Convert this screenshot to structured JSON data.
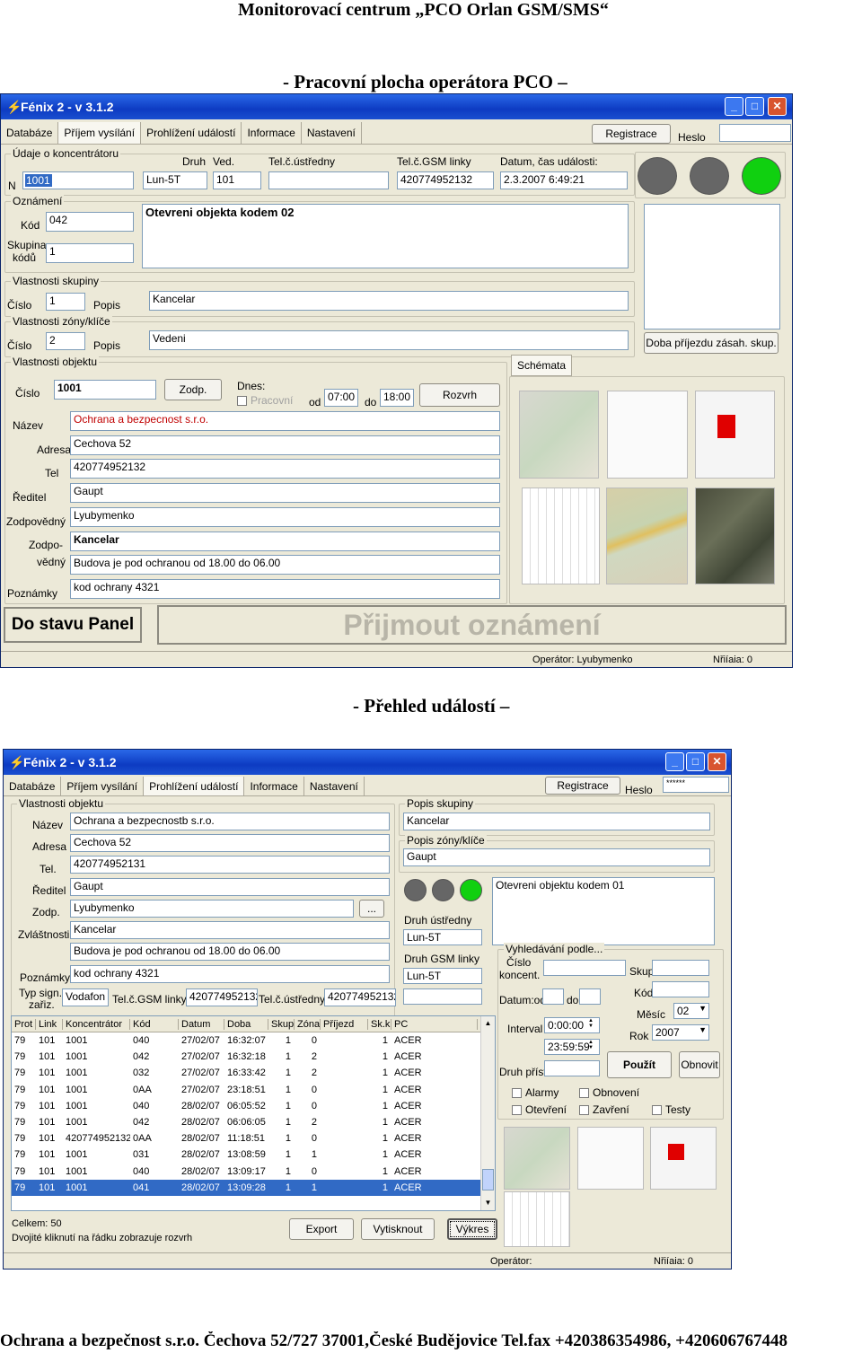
{
  "doc": {
    "header": "Monitorovací centrum „PCO Orlan GSM/SMS“",
    "section1": "-   Pracovní plocha operátora PCO –",
    "section2": "-   Přehled událostí –",
    "footer": "Ochrana a bezpečnost s.r.o.  Čechova 52/727  37001,České Budějovice  Tel.fax +420386354986,  +420606767448"
  },
  "w1": {
    "title": "Fénix 2 - v 3.1.2",
    "menu": [
      "Databáze",
      "Příjem vysílání",
      "Prohlížení událostí",
      "Informace",
      "Nastavení"
    ],
    "registrace": "Registrace",
    "heslo": "Heslo",
    "udaje_label": "Údaje o koncentrátoru",
    "druh_label": "Druh",
    "ved_label": "Ved.",
    "telc_label": "Tel.č.ústředny",
    "gsm_label": "Tel.č.GSM linky",
    "datum_label": "Datum, čas události:",
    "n_label": "N",
    "n_value": "1001",
    "druh_value": "Lun-5T",
    "ved_value": "101",
    "telc_value": "",
    "gsm_value": "420774952132",
    "datum_value": "2.3.2007 6:49:21",
    "oznameni_label": "Oznámení",
    "kod_label": "Kód",
    "kod_value": "042",
    "skupina_label1": "Skupina",
    "skupina_label2": "kódů",
    "skupina_value": "1",
    "message": "Otevreni objekta kodem  02",
    "vlsk_label": "Vlastnosti skupiny",
    "cislo_label": "Číslo",
    "popis_label": "Popis",
    "vlsk_cislo": "1",
    "vlsk_popis": "Kancelar",
    "vlzk_label": "Vlastnosti zóny/klíče",
    "vlzk_cislo": "2",
    "vlzk_popis": "Vedeni",
    "vlob_label": "Vlastnosti objektu",
    "ob_cislo": "1001",
    "zodp_btn": "Zodp.",
    "dnes_label": "Dnes:",
    "pracovni_label": "Pracovní",
    "od_label": "od",
    "od_value": "07:00",
    "do_label": "do",
    "do_value": "18:00",
    "rozvrh_btn": "Rozvrh",
    "nazev_label": "Název",
    "nazev_value": "Ochrana a bezpecnost s.r.o.",
    "adresa_label": "Adresa",
    "adresa_value": "Cechova 52",
    "tel_label": "Tel",
    "tel_value": "420774952132",
    "reditel_label": "Ředitel",
    "reditel_value": "Gaupt",
    "zodpovedny_label": "Zodpovědný",
    "zodpovedny_value": "Lyubymenko",
    "zodpoved_label1": "Zodpo-",
    "zodpoved_label2": "vědný",
    "zodpoved_value1": "Kancelar",
    "zodpoved_value2": "Budova je pod ochranou od 18.00 do 06.00",
    "poznamky_label": "Poznámky",
    "poznamky_value": "kod ochrany 4321",
    "doba_btn": "Doba příjezdu zásah. skup.",
    "schemata_tab": "Schémata",
    "stav_btn": "Do stavu Panel",
    "prijmout_btn": "Přijmout oznámení",
    "operator": "Operátor: Lyubymenko",
    "nrilaia": "Nřiíaia: 0",
    "lamps": [
      "#666666",
      "#666666",
      "#10d010"
    ]
  },
  "w2": {
    "title": "Fénix 2 - v 3.1.2",
    "menu": [
      "Databáze",
      "Příjem vysílání",
      "Prohlížení událostí",
      "Informace",
      "Nastavení"
    ],
    "registrace": "Registrace",
    "heslo": "Heslo",
    "heslo_value": "******",
    "vlob_label": "Vlastnosti objektu",
    "nazev_label": "Název",
    "nazev_value": "Ochrana a bezpecnostb s.r.o.",
    "adresa_label": "Adresa",
    "adresa_value": "Cechova 52",
    "tel_label": "Tel.",
    "tel_value": "420774952131",
    "reditel_label": "Ředitel",
    "reditel_value": "Gaupt",
    "zodp_label": "Zodp.",
    "zodp_value": "Lyubymenko",
    "dots_btn": "...",
    "zvl_label": "Zvláštnosti",
    "zvl_value1": "Kancelar",
    "zvl_value2": "Budova je pod ochranou od 18.00 do 06.00",
    "poznamky_label": "Poznámky",
    "poznamky_value": "kod ochrany 4321",
    "typsign_label1": "Typ sign.",
    "typsign_label2": "zařiz.",
    "typsign_value": "Vodafon",
    "gsm_label": "Tel.č.GSM linky",
    "gsm_value": "420774952132",
    "telc_label": "Tel.č.ústředny",
    "telc_value": "420774952132",
    "popsk_label": "Popis skupiny",
    "popsk_value": "Kancelar",
    "popzk_label": "Popis zóny/klíče",
    "popzk_value": "Gaupt",
    "message": "Otevreni objektu  kodem  01",
    "druh_ustr_label": "Druh ústředny",
    "druh_ustr_value": "Lun-5T",
    "druh_gsm_label": "Druh GSM linky",
    "druh_gsm_value": "Lun-5T",
    "vyhl_label": "Vyhledávání podle...",
    "cislo_koncent_label1": "Číslo",
    "cislo_koncent_label2": "koncent.",
    "skup_label": "Skup",
    "kod_label": "Kód",
    "datumod_label": "Datum:od",
    "do_label": "do",
    "mesic_label": "Měsíc",
    "mesic_value": "02",
    "rok_label": "Rok",
    "rok_value": "2007",
    "interval_label": "Interval",
    "interval_from": "0:00:00",
    "interval_to": "23:59:59",
    "druh_prist_label": "Druh příst.",
    "pouzit_btn": "Použít",
    "obnovit_btn": "Obnovit",
    "chk": [
      "Alarmy",
      "Obnovení",
      "Otevření",
      "Zavření",
      "Testy"
    ],
    "cols": [
      "Prot",
      "Link",
      "Koncentrátor",
      "Kód",
      "Datum",
      "Doba",
      "Skup",
      "Zóna",
      "Příjezd",
      "Sk.k",
      "PC"
    ],
    "rows": [
      [
        "79",
        "101",
        "1001",
        "040",
        "27/02/07",
        "16:32:07",
        "1",
        "0",
        "",
        "1",
        "ACER"
      ],
      [
        "79",
        "101",
        "1001",
        "042",
        "27/02/07",
        "16:32:18",
        "1",
        "2",
        "",
        "1",
        "ACER"
      ],
      [
        "79",
        "101",
        "1001",
        "032",
        "27/02/07",
        "16:33:42",
        "1",
        "2",
        "",
        "1",
        "ACER"
      ],
      [
        "79",
        "101",
        "1001",
        "0AA",
        "27/02/07",
        "23:18:51",
        "1",
        "0",
        "",
        "1",
        "ACER"
      ],
      [
        "79",
        "101",
        "1001",
        "040",
        "28/02/07",
        "06:05:52",
        "1",
        "0",
        "",
        "1",
        "ACER"
      ],
      [
        "79",
        "101",
        "1001",
        "042",
        "28/02/07",
        "06:06:05",
        "1",
        "2",
        "",
        "1",
        "ACER"
      ],
      [
        "79",
        "101",
        "420774952132",
        "0AA",
        "28/02/07",
        "11:18:51",
        "1",
        "0",
        "",
        "1",
        "ACER"
      ],
      [
        "79",
        "101",
        "1001",
        "031",
        "28/02/07",
        "13:08:59",
        "1",
        "1",
        "",
        "1",
        "ACER"
      ],
      [
        "79",
        "101",
        "1001",
        "040",
        "28/02/07",
        "13:09:17",
        "1",
        "0",
        "",
        "1",
        "ACER"
      ],
      [
        "79",
        "101",
        "1001",
        "041",
        "28/02/07",
        "13:09:28",
        "1",
        "1",
        "",
        "1",
        "ACER"
      ]
    ],
    "celkem": "Celkem: 50",
    "dvojite": "Dvojité kliknutí na řádku zobrazuje rozvrh",
    "export_btn": "Export",
    "vytisknout_btn": "Vytisknout",
    "vykres_btn": "Výkres",
    "operator": "Operátor:",
    "nrilaia": "Nřiíaia: 0",
    "lamps": [
      "#666666",
      "#666666",
      "#10d010"
    ]
  }
}
